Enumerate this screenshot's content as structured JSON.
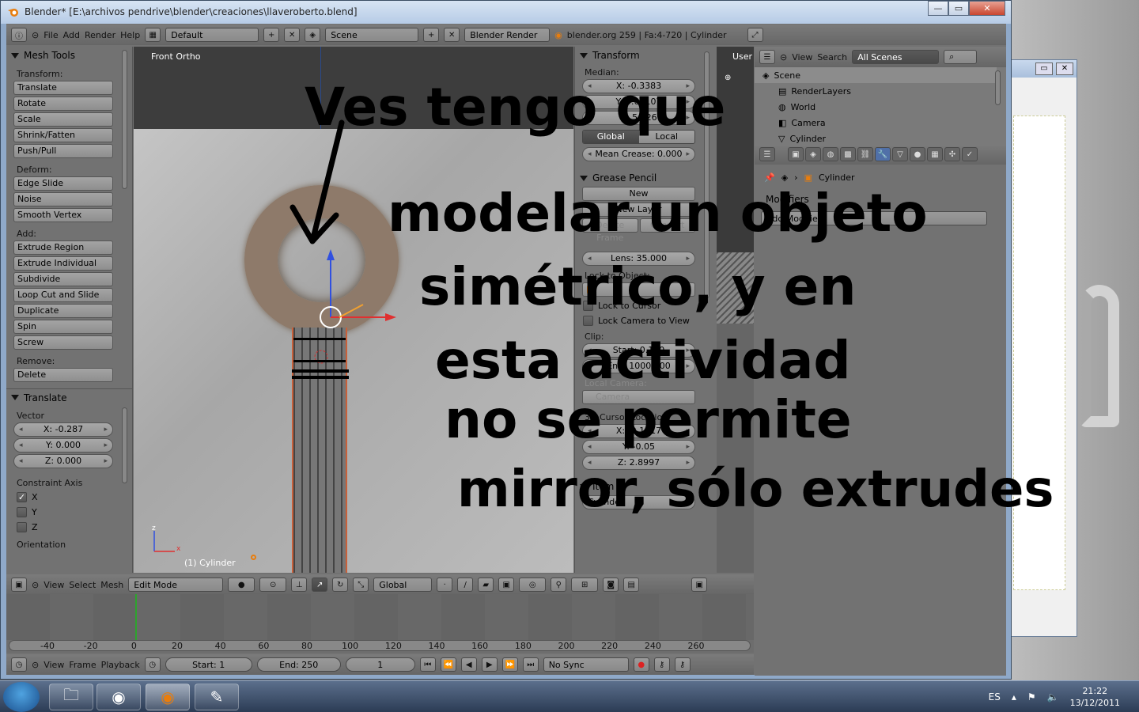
{
  "window": {
    "title": "Blender* [E:\\archivos pendrive\\blender\\creaciones\\llaveroberto.blend]",
    "min": "—",
    "max": "▭",
    "close": "✕"
  },
  "infobar": {
    "menus": [
      "File",
      "Add",
      "Render",
      "Help"
    ],
    "layout": "Default",
    "scene": "Scene",
    "engine": "Blender Render",
    "stats": "blender.org 259 | Fa:4-720 | Cylinder"
  },
  "toolshelf": {
    "title": "Mesh Tools",
    "sections": [
      {
        "label": "Transform:",
        "buttons": [
          "Translate",
          "Rotate",
          "Scale",
          "Shrink/Fatten",
          "Push/Pull"
        ]
      },
      {
        "label": "Deform:",
        "buttons": [
          "Edge Slide",
          "Noise",
          "Smooth Vertex"
        ]
      },
      {
        "label": "Add:",
        "buttons": [
          "Extrude Region",
          "Extrude Individual",
          "Subdivide",
          "Loop Cut and Slide",
          "Duplicate",
          "Spin",
          "Screw"
        ]
      },
      {
        "label": "Remove:",
        "buttons": [
          "Delete"
        ]
      }
    ]
  },
  "operator": {
    "title": "Translate",
    "vector_label": "Vector",
    "vector": [
      "X: -0.287",
      "Y: 0.000",
      "Z: 0.000"
    ],
    "constraint_label": "Constraint Axis",
    "axes": [
      {
        "label": "X",
        "checked": true
      },
      {
        "label": "Y",
        "checked": false
      },
      {
        "label": "Z",
        "checked": false
      }
    ],
    "orientation": "Orientation"
  },
  "viewport": {
    "view_name": "Front Ortho",
    "object_label": "(1) Cylinder",
    "axis_z": "z",
    "axis_x": "x"
  },
  "npanel": {
    "transform_title": "Transform",
    "median_label": "Median:",
    "median": [
      "X: -0.3383",
      "Y: 0.06107",
      "Z: 5.126"
    ],
    "space": [
      "Global",
      "Local"
    ],
    "crease": "Mean Crease: 0.000",
    "grease_title": "Grease Pencil",
    "grease_new": "New",
    "new_layer": "New Layer",
    "delete_frame": "Delete Frame",
    "convert": "Convert",
    "lens": "Lens: 35.000",
    "lock_object": "Lock to Object:",
    "lock_cursor": "Lock to Cursor",
    "lock_camera": "Lock Camera to View",
    "clip": "Clip:",
    "clip_start": "Start: 0.100",
    "clip_end": "End: 1000.000",
    "local_camera": "Local Camera:",
    "camera": "Camera",
    "cursor_label": "3D Cursor Location:",
    "cursor": [
      "X: -0.1617",
      "Y: -0.05",
      "Z: 2.8997"
    ],
    "item_title": "Item",
    "item_name": "Cylinder"
  },
  "userview": {
    "label": "User"
  },
  "outliner": {
    "menus": [
      "View",
      "Search"
    ],
    "filter": "All Scenes",
    "rows": [
      {
        "name": "Scene",
        "icon": "scene-icon",
        "selected": true
      },
      {
        "name": "RenderLayers",
        "icon": "render-layers-icon",
        "selected": false
      },
      {
        "name": "World",
        "icon": "world-icon",
        "selected": false
      },
      {
        "name": "Camera",
        "icon": "camera-icon",
        "selected": false
      },
      {
        "name": "Cylinder",
        "icon": "mesh-icon",
        "selected": false
      }
    ]
  },
  "properties": {
    "object": "Cylinder",
    "modifiers_title": "Modifiers",
    "add_modifier": "Add Modifier"
  },
  "viewport_header": {
    "menus": [
      "View",
      "Select",
      "Mesh"
    ],
    "mode": "Edit Mode",
    "orientation": "Global"
  },
  "timeline": {
    "ticks": [
      "-40",
      "-20",
      "0",
      "20",
      "40",
      "60",
      "80",
      "100",
      "120",
      "140",
      "160",
      "180",
      "200",
      "220",
      "240",
      "260"
    ],
    "menus": [
      "View",
      "Frame",
      "Playback"
    ],
    "start": "Start: 1",
    "end": "End: 250",
    "current": "1",
    "sync": "No Sync"
  },
  "taskbar": {
    "lang": "ES",
    "time": "21:22",
    "date": "13/12/2011"
  },
  "annotation": {
    "lines": [
      "Ves tengo que",
      "modelar un objeto",
      "simétrico, y en",
      "esta actividad",
      "no se permite",
      "mirror, sólo extrudes"
    ]
  }
}
